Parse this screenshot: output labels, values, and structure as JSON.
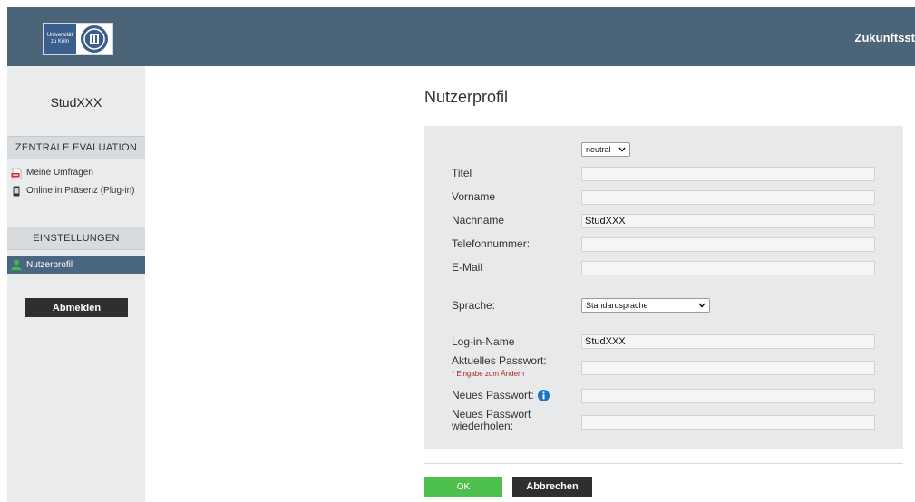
{
  "header": {
    "logo_line1": "Universität",
    "logo_line2": "zu Köln",
    "title": "Zukunftsst"
  },
  "sidebar": {
    "user_name": "StudXXX",
    "sections": [
      {
        "heading": "ZENTRALE EVALUATION",
        "items": [
          {
            "label": "Meine Umfragen",
            "icon": "pdf-icon"
          },
          {
            "label": "Online in Präsenz (Plug-in)",
            "icon": "phone-icon"
          }
        ]
      },
      {
        "heading": "EINSTELLUNGEN",
        "items": [
          {
            "label": "Nutzerprofil",
            "icon": "user-icon",
            "active": true
          }
        ]
      }
    ],
    "logout_label": "Abmelden"
  },
  "main": {
    "title": "Nutzerprofil",
    "salutation_select": "neutral",
    "fields": {
      "titel": {
        "label": "Titel",
        "value": ""
      },
      "vorname": {
        "label": "Vorname",
        "value": ""
      },
      "nachname": {
        "label": "Nachname",
        "value": "StudXXX"
      },
      "telefon": {
        "label": "Telefonnummer:",
        "value": ""
      },
      "email": {
        "label": "E-Mail",
        "value": ""
      },
      "sprache": {
        "label": "Sprache:",
        "value": "Standardsprache"
      },
      "login": {
        "label": "Log-in-Name",
        "value": "StudXXX"
      },
      "current_password": {
        "label": "Aktuelles Passwort:",
        "hint": "* Eingabe zum Ändern",
        "value": ""
      },
      "new_password": {
        "label": "Neues Passwort:",
        "value": ""
      },
      "repeat_password": {
        "label_line1": "Neues Passwort",
        "label_line2": "wiederholen:",
        "value": ""
      }
    },
    "ok_label": "OK",
    "cancel_label": "Abbrechen"
  },
  "colors": {
    "header_bg": "#4c6478",
    "active_nav_bg": "#4a6782",
    "ok_button": "#4cc04a",
    "dark_button": "#2f2f2f",
    "hint_red": "#b22222",
    "info_blue": "#1e73be"
  }
}
